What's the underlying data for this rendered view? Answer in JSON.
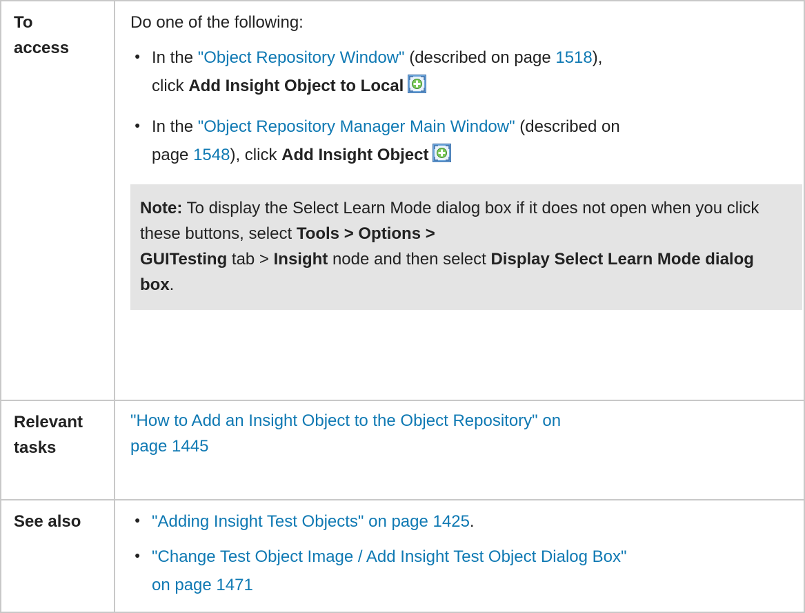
{
  "rows": {
    "access": {
      "label_line1": "To",
      "label_line2": "access",
      "intro": "Do one of the following:",
      "bullet1": {
        "prefix": "In the ",
        "link": "\"Object Repository Window\"",
        "middle": " (described on page ",
        "page": "1518",
        "suffix": "),",
        "click_text": "click ",
        "action": "Add Insight Object to Local",
        "icon": "add-insight-object-icon"
      },
      "bullet2": {
        "prefix": "In the ",
        "link": "\"Object Repository Manager Main Window\"",
        "middle": " (described on",
        "line2_prefix": "page ",
        "page": "1548",
        "suffix": "), click ",
        "action": "Add Insight Object",
        "icon": "add-insight-object-icon"
      },
      "note": {
        "label": "Note:",
        "text1": " To display the Select Learn Mode dialog box if it does not open when you click these buttons, select ",
        "path1": "Tools > Options >",
        "path2": "GUITesting",
        "text2": " tab > ",
        "path3": "Insight",
        "text3": " node and then select ",
        "path4": "Display Select Learn Mode dialog box",
        "end": "."
      }
    },
    "tasks": {
      "label_line1": "Relevant",
      "label_line2": "tasks",
      "link_line1": "\"How to Add an Insight Object to the Object Repository\" on",
      "link_line2": "page 1445"
    },
    "see_also": {
      "label": "See also",
      "item1": "\"Adding Insight Test Objects\" on page 1425",
      "item1_suffix": ".",
      "item2_line1": "\"Change Test Object Image / Add Insight Test Object Dialog Box\"",
      "item2_line2": "on page 1471"
    }
  },
  "colors": {
    "link": "#0f79b3",
    "note_bg": "#e4e4e4",
    "border": "#c8c8c8",
    "text": "#222222"
  }
}
